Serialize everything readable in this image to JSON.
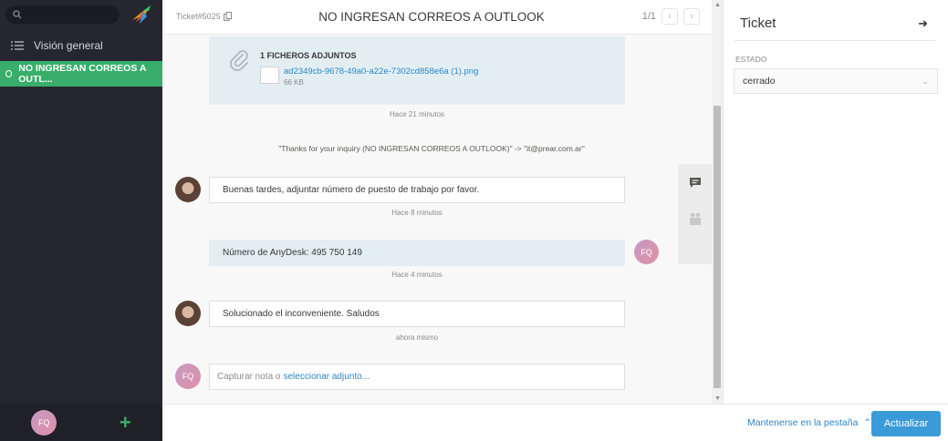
{
  "nav": {
    "overview_label": "Visión general",
    "active_ticket_label": "NO INGRESAN CORREOS A OUTL...",
    "user_initials": "FQ",
    "add_label": "+"
  },
  "header": {
    "ticket_number": "Ticket#5025",
    "title": "NO INGRESAN CORREOS A OUTLOOK",
    "pager": "1/1"
  },
  "attachment": {
    "title": "1 FICHEROS ADJUNTOS",
    "file_name": "ad2349cb-9678-49a0-a22e-7302cd858e6a (1).png",
    "file_size": "66 KB",
    "time": "Hace 21 minutos"
  },
  "system_message": "\"Thanks for your inquiry (NO INGRESAN CORREOS A OUTLOOK)\" -> \"it@prear.com.ar\"",
  "messages": [
    {
      "text": "Buenas tardes, adjuntar número de puesto de trabajo por favor.",
      "time": "Hace 8 minutos"
    },
    {
      "text": "Número de AnyDesk: 495 750 149",
      "time": "Hace 4 minutos",
      "author_initials": "FQ"
    },
    {
      "text": "Solucionado el inconveniente. Saludos",
      "time": "ahora mismo"
    }
  ],
  "compose": {
    "placeholder": "Capturar nota o",
    "attach_link": "seleccionar adjunto...",
    "author_initials": "FQ"
  },
  "sidebar": {
    "title": "Ticket",
    "state_label": "ESTADO",
    "state_value": "cerrado"
  },
  "footer": {
    "stay_tab_label": "Mantenerse en la pestaña",
    "update_label": "Actualizar"
  },
  "colors": {
    "nav_bg": "#26272e",
    "accent_green": "#38ae6a",
    "link_blue": "#2a87c7",
    "button_blue": "#3b9bd8",
    "internal_note_bg": "#e3eef3"
  }
}
